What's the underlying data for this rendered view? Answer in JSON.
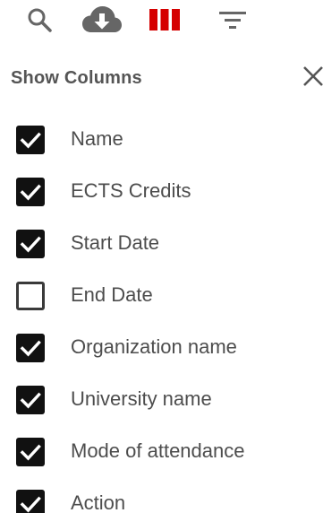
{
  "toolbar": {
    "buttons": [
      {
        "name": "search-button",
        "icon": "search-icon"
      },
      {
        "name": "download-button",
        "icon": "cloud-download-icon"
      },
      {
        "name": "view-columns-button",
        "icon": "view-columns-icon",
        "active": true
      },
      {
        "name": "filter-button",
        "icon": "filter-icon"
      }
    ],
    "accent_color": "#d50000"
  },
  "panel": {
    "title": "Show Columns",
    "close_icon": "close-icon"
  },
  "columns": [
    {
      "label": "Name",
      "checked": true
    },
    {
      "label": "ECTS Credits",
      "checked": true
    },
    {
      "label": "Start Date",
      "checked": true
    },
    {
      "label": "End Date",
      "checked": false
    },
    {
      "label": "Organization name",
      "checked": true
    },
    {
      "label": "University name",
      "checked": true
    },
    {
      "label": "Mode of attendance",
      "checked": true
    },
    {
      "label": "Action",
      "checked": true
    }
  ]
}
